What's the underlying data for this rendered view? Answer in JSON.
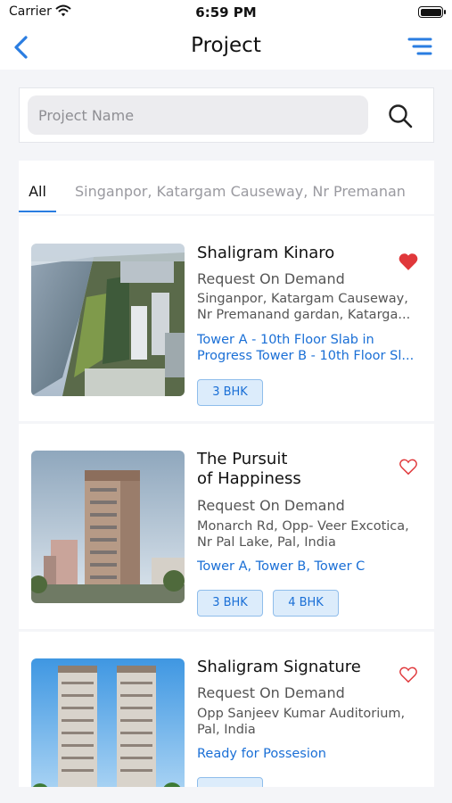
{
  "status_bar": {
    "carrier": "Carrier",
    "time": "6:59 PM"
  },
  "nav": {
    "title": "Project",
    "back_icon": "chevron-left-icon",
    "menu_icon": "filter-menu-icon"
  },
  "search": {
    "placeholder": "Project Name",
    "icon": "search-icon"
  },
  "tabs": [
    {
      "label": "All",
      "selected": true
    },
    {
      "label": "Singanpor, Katargam Causeway, Nr Premanan",
      "selected": false
    }
  ],
  "colors": {
    "accent": "#2a7de1",
    "link": "#1a6fd6",
    "favorite": "#e0383b",
    "badge_bg": "#dcecfb"
  },
  "projects": [
    {
      "name": "Shaligram Kinaro",
      "status": "Request On Demand",
      "address_line1": "Singanpor, Katargam Causeway,",
      "address_line2": "Nr Premanand gardan, Katarga...",
      "progress_line1": "Tower A - 10th Floor Slab in",
      "progress_line2": "Progress Tower B - 10th Floor Sl...",
      "favorite": true,
      "badges": [
        "3 BHK"
      ]
    },
    {
      "name_line1": "The Pursuit",
      "name_line2": "of Happiness",
      "status": "Request On Demand",
      "address_line1": "Monarch Rd, Opp- Veer Excotica,",
      "address_line2": "Nr Pal Lake, Pal, India",
      "progress_line1": "Tower A, Tower B, Tower C",
      "favorite": false,
      "badges": [
        "3 BHK",
        "4 BHK"
      ]
    },
    {
      "name": "Shaligram Signature",
      "status": "Request On Demand",
      "address_line1": "Opp Sanjeev Kumar Auditorium,",
      "address_line2": "Pal, India",
      "progress_line1": "Ready for Possesion",
      "favorite": false,
      "badges": [
        ""
      ]
    }
  ]
}
